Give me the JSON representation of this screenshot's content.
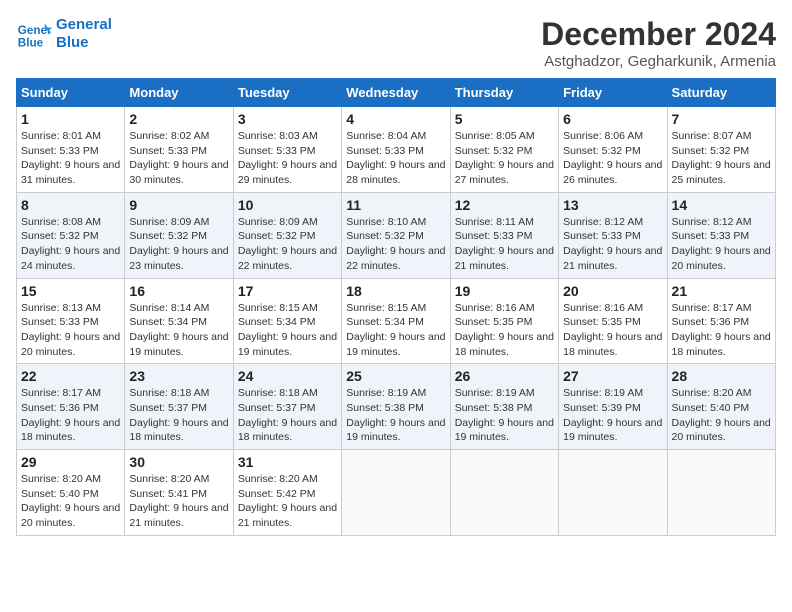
{
  "header": {
    "logo_line1": "General",
    "logo_line2": "Blue",
    "month": "December 2024",
    "location": "Astghadzor, Gegharkunik, Armenia"
  },
  "weekdays": [
    "Sunday",
    "Monday",
    "Tuesday",
    "Wednesday",
    "Thursday",
    "Friday",
    "Saturday"
  ],
  "weeks": [
    [
      {
        "day": "1",
        "sunrise": "8:01 AM",
        "sunset": "5:33 PM",
        "daylight": "9 hours and 31 minutes."
      },
      {
        "day": "2",
        "sunrise": "8:02 AM",
        "sunset": "5:33 PM",
        "daylight": "9 hours and 30 minutes."
      },
      {
        "day": "3",
        "sunrise": "8:03 AM",
        "sunset": "5:33 PM",
        "daylight": "9 hours and 29 minutes."
      },
      {
        "day": "4",
        "sunrise": "8:04 AM",
        "sunset": "5:33 PM",
        "daylight": "9 hours and 28 minutes."
      },
      {
        "day": "5",
        "sunrise": "8:05 AM",
        "sunset": "5:32 PM",
        "daylight": "9 hours and 27 minutes."
      },
      {
        "day": "6",
        "sunrise": "8:06 AM",
        "sunset": "5:32 PM",
        "daylight": "9 hours and 26 minutes."
      },
      {
        "day": "7",
        "sunrise": "8:07 AM",
        "sunset": "5:32 PM",
        "daylight": "9 hours and 25 minutes."
      }
    ],
    [
      {
        "day": "8",
        "sunrise": "8:08 AM",
        "sunset": "5:32 PM",
        "daylight": "9 hours and 24 minutes."
      },
      {
        "day": "9",
        "sunrise": "8:09 AM",
        "sunset": "5:32 PM",
        "daylight": "9 hours and 23 minutes."
      },
      {
        "day": "10",
        "sunrise": "8:09 AM",
        "sunset": "5:32 PM",
        "daylight": "9 hours and 22 minutes."
      },
      {
        "day": "11",
        "sunrise": "8:10 AM",
        "sunset": "5:32 PM",
        "daylight": "9 hours and 22 minutes."
      },
      {
        "day": "12",
        "sunrise": "8:11 AM",
        "sunset": "5:33 PM",
        "daylight": "9 hours and 21 minutes."
      },
      {
        "day": "13",
        "sunrise": "8:12 AM",
        "sunset": "5:33 PM",
        "daylight": "9 hours and 21 minutes."
      },
      {
        "day": "14",
        "sunrise": "8:12 AM",
        "sunset": "5:33 PM",
        "daylight": "9 hours and 20 minutes."
      }
    ],
    [
      {
        "day": "15",
        "sunrise": "8:13 AM",
        "sunset": "5:33 PM",
        "daylight": "9 hours and 20 minutes."
      },
      {
        "day": "16",
        "sunrise": "8:14 AM",
        "sunset": "5:34 PM",
        "daylight": "9 hours and 19 minutes."
      },
      {
        "day": "17",
        "sunrise": "8:15 AM",
        "sunset": "5:34 PM",
        "daylight": "9 hours and 19 minutes."
      },
      {
        "day": "18",
        "sunrise": "8:15 AM",
        "sunset": "5:34 PM",
        "daylight": "9 hours and 19 minutes."
      },
      {
        "day": "19",
        "sunrise": "8:16 AM",
        "sunset": "5:35 PM",
        "daylight": "9 hours and 18 minutes."
      },
      {
        "day": "20",
        "sunrise": "8:16 AM",
        "sunset": "5:35 PM",
        "daylight": "9 hours and 18 minutes."
      },
      {
        "day": "21",
        "sunrise": "8:17 AM",
        "sunset": "5:36 PM",
        "daylight": "9 hours and 18 minutes."
      }
    ],
    [
      {
        "day": "22",
        "sunrise": "8:17 AM",
        "sunset": "5:36 PM",
        "daylight": "9 hours and 18 minutes."
      },
      {
        "day": "23",
        "sunrise": "8:18 AM",
        "sunset": "5:37 PM",
        "daylight": "9 hours and 18 minutes."
      },
      {
        "day": "24",
        "sunrise": "8:18 AM",
        "sunset": "5:37 PM",
        "daylight": "9 hours and 18 minutes."
      },
      {
        "day": "25",
        "sunrise": "8:19 AM",
        "sunset": "5:38 PM",
        "daylight": "9 hours and 19 minutes."
      },
      {
        "day": "26",
        "sunrise": "8:19 AM",
        "sunset": "5:38 PM",
        "daylight": "9 hours and 19 minutes."
      },
      {
        "day": "27",
        "sunrise": "8:19 AM",
        "sunset": "5:39 PM",
        "daylight": "9 hours and 19 minutes."
      },
      {
        "day": "28",
        "sunrise": "8:20 AM",
        "sunset": "5:40 PM",
        "daylight": "9 hours and 20 minutes."
      }
    ],
    [
      {
        "day": "29",
        "sunrise": "8:20 AM",
        "sunset": "5:40 PM",
        "daylight": "9 hours and 20 minutes."
      },
      {
        "day": "30",
        "sunrise": "8:20 AM",
        "sunset": "5:41 PM",
        "daylight": "9 hours and 21 minutes."
      },
      {
        "day": "31",
        "sunrise": "8:20 AM",
        "sunset": "5:42 PM",
        "daylight": "9 hours and 21 minutes."
      },
      null,
      null,
      null,
      null
    ]
  ],
  "labels": {
    "sunrise": "Sunrise:",
    "sunset": "Sunset:",
    "daylight": "Daylight:"
  }
}
